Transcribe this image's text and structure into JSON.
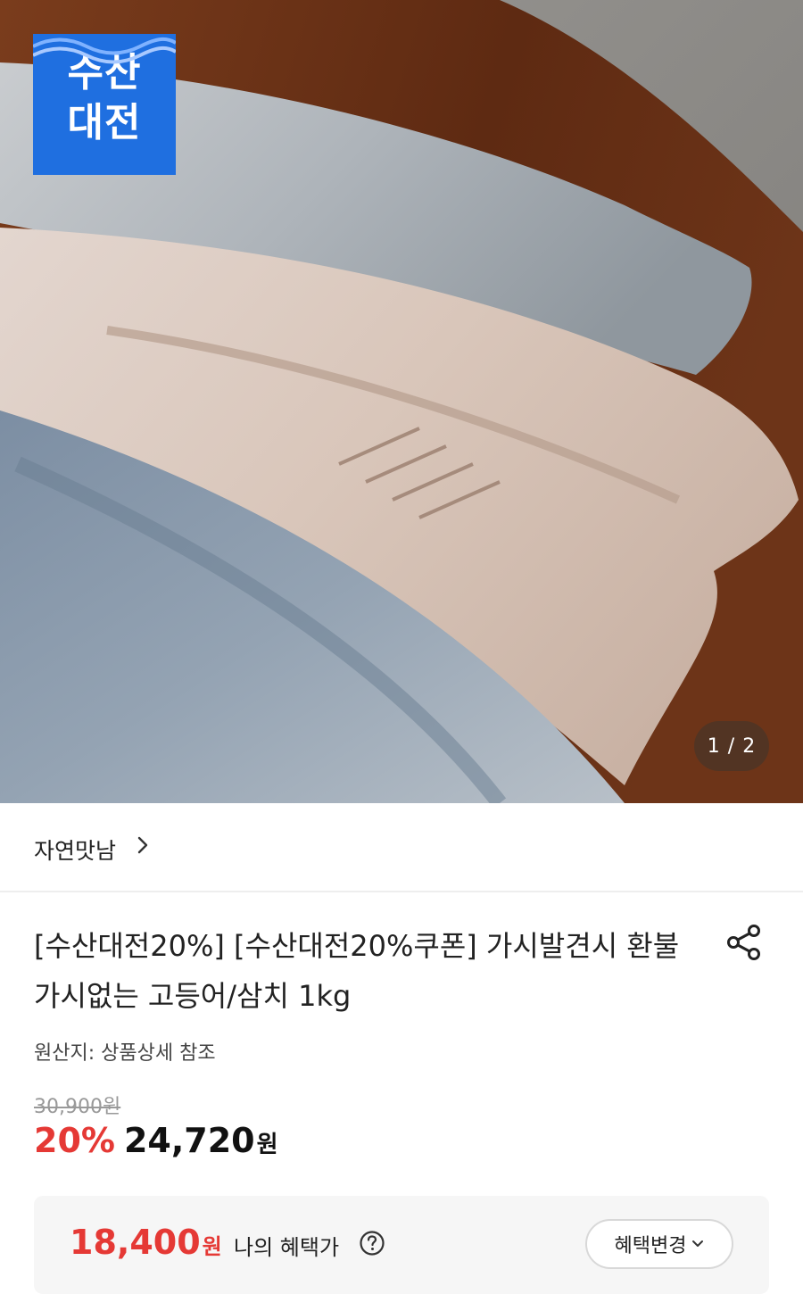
{
  "brand_badge": {
    "line1": "수산",
    "line2": "대전"
  },
  "image_counter": "1 / 2",
  "store": {
    "name": "자연맛남"
  },
  "product": {
    "title": "[수산대전20%] [수산대전20%쿠폰] 가시발견시 환불 가시없는 고등어/삼치 1kg",
    "origin": "원산지: 상품상세 참조",
    "original_price": "30,900원",
    "discount": "20%",
    "sale_price": "24,720",
    "currency": "원"
  },
  "benefit": {
    "price": "18,400",
    "currency": "원",
    "label": "나의 혜택가",
    "change_button": "혜택변경"
  },
  "icons": {
    "store_chevron": "chevron-right-icon",
    "share": "share-icon",
    "help": "question-circle-icon",
    "dropdown": "chevron-down-icon"
  },
  "colors": {
    "discount_red": "#e53935",
    "badge_blue": "#1f6fe0"
  }
}
